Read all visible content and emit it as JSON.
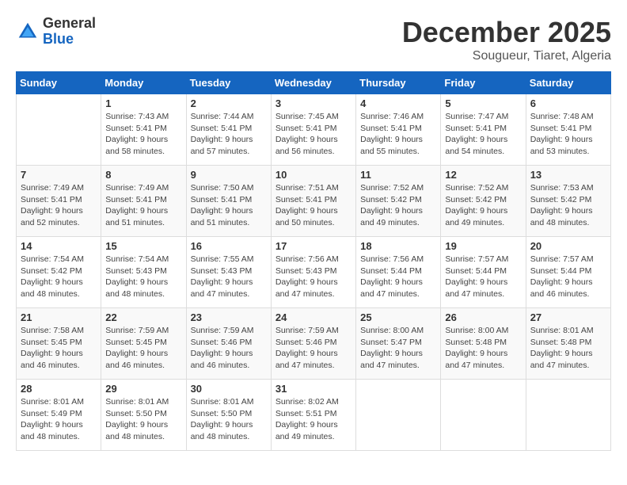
{
  "header": {
    "logo": {
      "general": "General",
      "blue": "Blue"
    },
    "title": "December 2025",
    "subtitle": "Sougueur, Tiaret, Algeria"
  },
  "days_of_week": [
    "Sunday",
    "Monday",
    "Tuesday",
    "Wednesday",
    "Thursday",
    "Friday",
    "Saturday"
  ],
  "weeks": [
    [
      {
        "day": "",
        "info": ""
      },
      {
        "day": "1",
        "info": "Sunrise: 7:43 AM\nSunset: 5:41 PM\nDaylight: 9 hours\nand 58 minutes."
      },
      {
        "day": "2",
        "info": "Sunrise: 7:44 AM\nSunset: 5:41 PM\nDaylight: 9 hours\nand 57 minutes."
      },
      {
        "day": "3",
        "info": "Sunrise: 7:45 AM\nSunset: 5:41 PM\nDaylight: 9 hours\nand 56 minutes."
      },
      {
        "day": "4",
        "info": "Sunrise: 7:46 AM\nSunset: 5:41 PM\nDaylight: 9 hours\nand 55 minutes."
      },
      {
        "day": "5",
        "info": "Sunrise: 7:47 AM\nSunset: 5:41 PM\nDaylight: 9 hours\nand 54 minutes."
      },
      {
        "day": "6",
        "info": "Sunrise: 7:48 AM\nSunset: 5:41 PM\nDaylight: 9 hours\nand 53 minutes."
      }
    ],
    [
      {
        "day": "7",
        "info": "Sunrise: 7:49 AM\nSunset: 5:41 PM\nDaylight: 9 hours\nand 52 minutes."
      },
      {
        "day": "8",
        "info": "Sunrise: 7:49 AM\nSunset: 5:41 PM\nDaylight: 9 hours\nand 51 minutes."
      },
      {
        "day": "9",
        "info": "Sunrise: 7:50 AM\nSunset: 5:41 PM\nDaylight: 9 hours\nand 51 minutes."
      },
      {
        "day": "10",
        "info": "Sunrise: 7:51 AM\nSunset: 5:41 PM\nDaylight: 9 hours\nand 50 minutes."
      },
      {
        "day": "11",
        "info": "Sunrise: 7:52 AM\nSunset: 5:42 PM\nDaylight: 9 hours\nand 49 minutes."
      },
      {
        "day": "12",
        "info": "Sunrise: 7:52 AM\nSunset: 5:42 PM\nDaylight: 9 hours\nand 49 minutes."
      },
      {
        "day": "13",
        "info": "Sunrise: 7:53 AM\nSunset: 5:42 PM\nDaylight: 9 hours\nand 48 minutes."
      }
    ],
    [
      {
        "day": "14",
        "info": "Sunrise: 7:54 AM\nSunset: 5:42 PM\nDaylight: 9 hours\nand 48 minutes."
      },
      {
        "day": "15",
        "info": "Sunrise: 7:54 AM\nSunset: 5:43 PM\nDaylight: 9 hours\nand 48 minutes."
      },
      {
        "day": "16",
        "info": "Sunrise: 7:55 AM\nSunset: 5:43 PM\nDaylight: 9 hours\nand 47 minutes."
      },
      {
        "day": "17",
        "info": "Sunrise: 7:56 AM\nSunset: 5:43 PM\nDaylight: 9 hours\nand 47 minutes."
      },
      {
        "day": "18",
        "info": "Sunrise: 7:56 AM\nSunset: 5:44 PM\nDaylight: 9 hours\nand 47 minutes."
      },
      {
        "day": "19",
        "info": "Sunrise: 7:57 AM\nSunset: 5:44 PM\nDaylight: 9 hours\nand 47 minutes."
      },
      {
        "day": "20",
        "info": "Sunrise: 7:57 AM\nSunset: 5:44 PM\nDaylight: 9 hours\nand 46 minutes."
      }
    ],
    [
      {
        "day": "21",
        "info": "Sunrise: 7:58 AM\nSunset: 5:45 PM\nDaylight: 9 hours\nand 46 minutes."
      },
      {
        "day": "22",
        "info": "Sunrise: 7:59 AM\nSunset: 5:45 PM\nDaylight: 9 hours\nand 46 minutes."
      },
      {
        "day": "23",
        "info": "Sunrise: 7:59 AM\nSunset: 5:46 PM\nDaylight: 9 hours\nand 46 minutes."
      },
      {
        "day": "24",
        "info": "Sunrise: 7:59 AM\nSunset: 5:46 PM\nDaylight: 9 hours\nand 47 minutes."
      },
      {
        "day": "25",
        "info": "Sunrise: 8:00 AM\nSunset: 5:47 PM\nDaylight: 9 hours\nand 47 minutes."
      },
      {
        "day": "26",
        "info": "Sunrise: 8:00 AM\nSunset: 5:48 PM\nDaylight: 9 hours\nand 47 minutes."
      },
      {
        "day": "27",
        "info": "Sunrise: 8:01 AM\nSunset: 5:48 PM\nDaylight: 9 hours\nand 47 minutes."
      }
    ],
    [
      {
        "day": "28",
        "info": "Sunrise: 8:01 AM\nSunset: 5:49 PM\nDaylight: 9 hours\nand 48 minutes."
      },
      {
        "day": "29",
        "info": "Sunrise: 8:01 AM\nSunset: 5:50 PM\nDaylight: 9 hours\nand 48 minutes."
      },
      {
        "day": "30",
        "info": "Sunrise: 8:01 AM\nSunset: 5:50 PM\nDaylight: 9 hours\nand 48 minutes."
      },
      {
        "day": "31",
        "info": "Sunrise: 8:02 AM\nSunset: 5:51 PM\nDaylight: 9 hours\nand 49 minutes."
      },
      {
        "day": "",
        "info": ""
      },
      {
        "day": "",
        "info": ""
      },
      {
        "day": "",
        "info": ""
      }
    ]
  ]
}
